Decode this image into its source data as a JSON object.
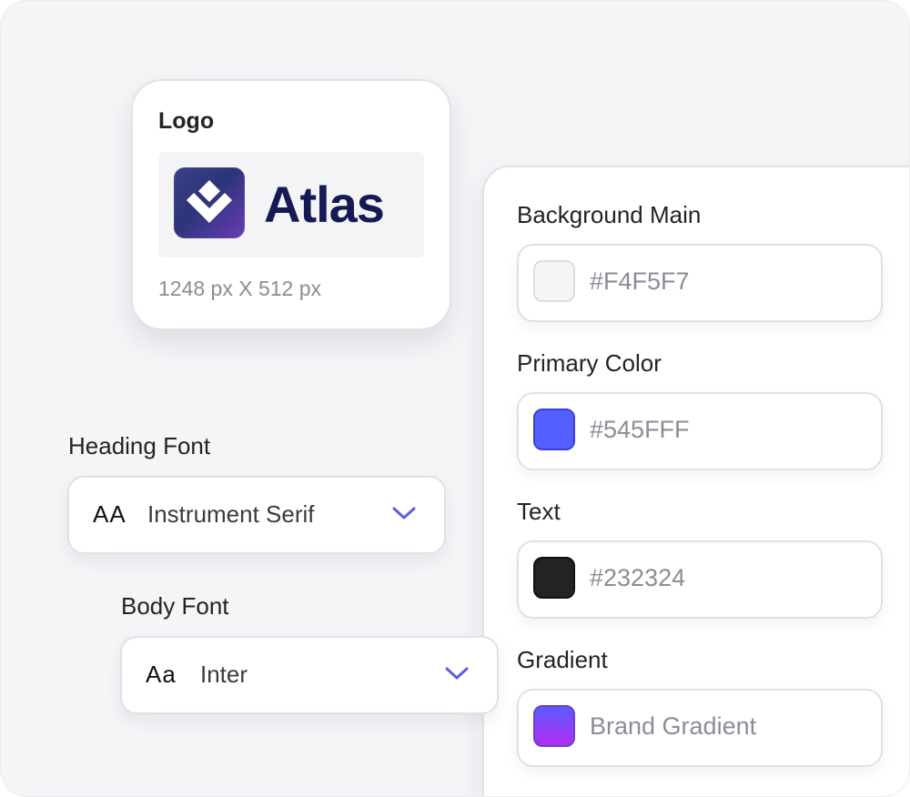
{
  "logo_card": {
    "title": "Logo",
    "wordmark": "Atlas",
    "dimensions": "1248 px X 512 px",
    "mark_icon": "diamond-chevron-logo-icon"
  },
  "heading_font": {
    "label": "Heading Font",
    "glyph": "AA",
    "value": "Instrument Serif",
    "icon": "chevron-down-icon"
  },
  "body_font": {
    "label": "Body Font",
    "glyph": "Aa",
    "value": "Inter",
    "icon": "chevron-down-icon"
  },
  "colors": {
    "background_main": {
      "label": "Background Main",
      "value": "#F4F5F7",
      "swatch": "#F4F5F7"
    },
    "primary": {
      "label": "Primary Color",
      "value": "#545FFF",
      "swatch": "#545FFF"
    },
    "text": {
      "label": "Text",
      "value": "#232324",
      "swatch": "#232324"
    },
    "gradient": {
      "label": "Gradient",
      "value": "Brand Gradient",
      "swatch_from": "#5b5cff",
      "swatch_to": "#b42cf0"
    }
  },
  "accent_color": "#5a5fe0"
}
